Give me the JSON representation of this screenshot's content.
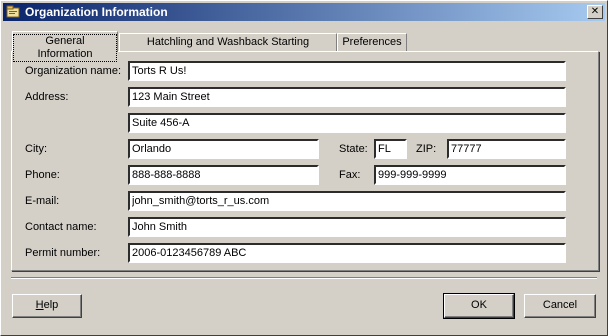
{
  "window": {
    "title": "Organization Information",
    "close_glyph": "✕"
  },
  "tabs": [
    {
      "label": "General Information"
    },
    {
      "label": "Hatchling and Washback Starting Balances"
    },
    {
      "label": "Preferences"
    }
  ],
  "form": {
    "org_name": {
      "label": "Organization name:",
      "value": "Torts R Us!"
    },
    "address": {
      "label": "Address:",
      "line1": "123 Main Street",
      "line2": "Suite 456-A"
    },
    "city": {
      "label": "City:",
      "value": "Orlando"
    },
    "state": {
      "label": "State:",
      "value": "FL"
    },
    "zip": {
      "label": "ZIP:",
      "value": "77777"
    },
    "phone": {
      "label": "Phone:",
      "value": "888-888-8888"
    },
    "fax": {
      "label": "Fax:",
      "value": "999-999-9999"
    },
    "email": {
      "label": "E-mail:",
      "value": "john_smith@torts_r_us.com"
    },
    "contact": {
      "label": "Contact name:",
      "value": "John Smith"
    },
    "permit": {
      "label": "Permit number:",
      "value": "2006-0123456789 ABC"
    }
  },
  "buttons": {
    "help_mnemonic": "H",
    "help_rest": "elp",
    "ok": "OK",
    "cancel": "Cancel"
  }
}
